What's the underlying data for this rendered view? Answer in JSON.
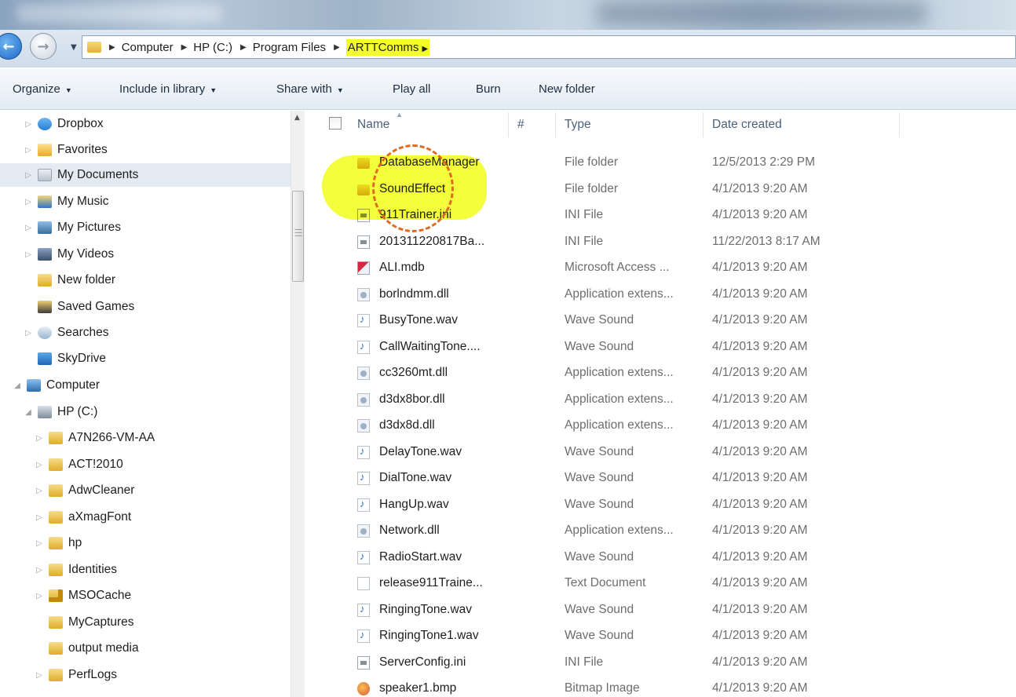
{
  "window": {
    "title": ""
  },
  "address_bar": {
    "crumbs": [
      "Computer",
      "HP (C:)",
      "Program Files",
      "ARTTComms"
    ],
    "highlighted_crumb": "ARTTComms"
  },
  "command_bar": {
    "organize": "Organize",
    "include_in_library": "Include in library",
    "share_with": "Share with",
    "play_all": "Play all",
    "burn": "Burn",
    "new_folder": "New folder"
  },
  "nav_pane": {
    "items": [
      {
        "label": "Dropbox",
        "icon": "dropbox-icon",
        "expander": true
      },
      {
        "label": "Favorites",
        "icon": "favorites-icon",
        "expander": true
      },
      {
        "label": "My Documents",
        "icon": "documents-icon",
        "expander": true,
        "selected": true
      },
      {
        "label": "My Music",
        "icon": "music-icon",
        "expander": true
      },
      {
        "label": "My Pictures",
        "icon": "pictures-icon",
        "expander": true
      },
      {
        "label": "My Videos",
        "icon": "videos-icon",
        "expander": true
      },
      {
        "label": "New folder",
        "icon": "folder-icon",
        "expander": false
      },
      {
        "label": "Saved Games",
        "icon": "saved-games-icon",
        "expander": false
      },
      {
        "label": "Searches",
        "icon": "searches-icon",
        "expander": true
      },
      {
        "label": "SkyDrive",
        "icon": "skydrive-icon",
        "expander": false
      },
      {
        "label": "Computer",
        "icon": "computer-icon",
        "expander": true,
        "expanded": true
      },
      {
        "label": "HP (C:)",
        "icon": "drive-icon",
        "expander": true,
        "expanded": true
      },
      {
        "label": "A7N266-VM-AA",
        "icon": "folder-icon",
        "expander": true
      },
      {
        "label": "ACT!2010",
        "icon": "folder-icon",
        "expander": true
      },
      {
        "label": "AdwCleaner",
        "icon": "folder-icon",
        "expander": true
      },
      {
        "label": "aXmagFont",
        "icon": "folder-icon",
        "expander": true
      },
      {
        "label": "hp",
        "icon": "folder-icon",
        "expander": true
      },
      {
        "label": "Identities",
        "icon": "folder-icon",
        "expander": true
      },
      {
        "label": "MSOCache",
        "icon": "locked-folder-icon",
        "expander": true
      },
      {
        "label": "MyCaptures",
        "icon": "folder-icon",
        "expander": false
      },
      {
        "label": "output media",
        "icon": "folder-icon",
        "expander": false
      },
      {
        "label": "PerfLogs",
        "icon": "folder-icon",
        "expander": true
      }
    ]
  },
  "file_list": {
    "columns": {
      "name": "Name",
      "num": "#",
      "type": "Type",
      "date_created": "Date created"
    },
    "sort_column": "Name",
    "rows": [
      {
        "name": "DatabaseManager",
        "type": "File folder",
        "date": "12/5/2013 2:29 PM",
        "icon": "folder"
      },
      {
        "name": "SoundEffect",
        "type": "File folder",
        "date": "4/1/2013 9:20 AM",
        "icon": "folder"
      },
      {
        "name": "911Trainer.ini",
        "type": "INI File",
        "date": "4/1/2013 9:20 AM",
        "icon": "ini"
      },
      {
        "name": "201311220817Ba...",
        "type": "INI File",
        "date": "11/22/2013 8:17 AM",
        "icon": "ini"
      },
      {
        "name": "ALI.mdb",
        "type": "Microsoft Access ...",
        "date": "4/1/2013 9:20 AM",
        "icon": "mdb"
      },
      {
        "name": "borlndmm.dll",
        "type": "Application extens...",
        "date": "4/1/2013 9:20 AM",
        "icon": "dll"
      },
      {
        "name": "BusyTone.wav",
        "type": "Wave Sound",
        "date": "4/1/2013 9:20 AM",
        "icon": "wav"
      },
      {
        "name": "CallWaitingTone....",
        "type": "Wave Sound",
        "date": "4/1/2013 9:20 AM",
        "icon": "wav"
      },
      {
        "name": "cc3260mt.dll",
        "type": "Application extens...",
        "date": "4/1/2013 9:20 AM",
        "icon": "dll"
      },
      {
        "name": "d3dx8bor.dll",
        "type": "Application extens...",
        "date": "4/1/2013 9:20 AM",
        "icon": "dll"
      },
      {
        "name": "d3dx8d.dll",
        "type": "Application extens...",
        "date": "4/1/2013 9:20 AM",
        "icon": "dll"
      },
      {
        "name": "DelayTone.wav",
        "type": "Wave Sound",
        "date": "4/1/2013 9:20 AM",
        "icon": "wav"
      },
      {
        "name": "DialTone.wav",
        "type": "Wave Sound",
        "date": "4/1/2013 9:20 AM",
        "icon": "wav"
      },
      {
        "name": "HangUp.wav",
        "type": "Wave Sound",
        "date": "4/1/2013 9:20 AM",
        "icon": "wav"
      },
      {
        "name": "Network.dll",
        "type": "Application extens...",
        "date": "4/1/2013 9:20 AM",
        "icon": "dll"
      },
      {
        "name": "RadioStart.wav",
        "type": "Wave Sound",
        "date": "4/1/2013 9:20 AM",
        "icon": "wav"
      },
      {
        "name": "release911Traine...",
        "type": "Text Document",
        "date": "4/1/2013 9:20 AM",
        "icon": "txt"
      },
      {
        "name": "RingingTone.wav",
        "type": "Wave Sound",
        "date": "4/1/2013 9:20 AM",
        "icon": "wav"
      },
      {
        "name": "RingingTone1.wav",
        "type": "Wave Sound",
        "date": "4/1/2013 9:20 AM",
        "icon": "wav"
      },
      {
        "name": "ServerConfig.ini",
        "type": "INI File",
        "date": "4/1/2013 9:20 AM",
        "icon": "ini"
      },
      {
        "name": "speaker1.bmp",
        "type": "Bitmap Image",
        "date": "4/1/2013 9:20 AM",
        "icon": "bmp"
      }
    ]
  },
  "annotations": {
    "highlight_color": "#f4ff2a",
    "circle_color": "#e06a1f"
  }
}
